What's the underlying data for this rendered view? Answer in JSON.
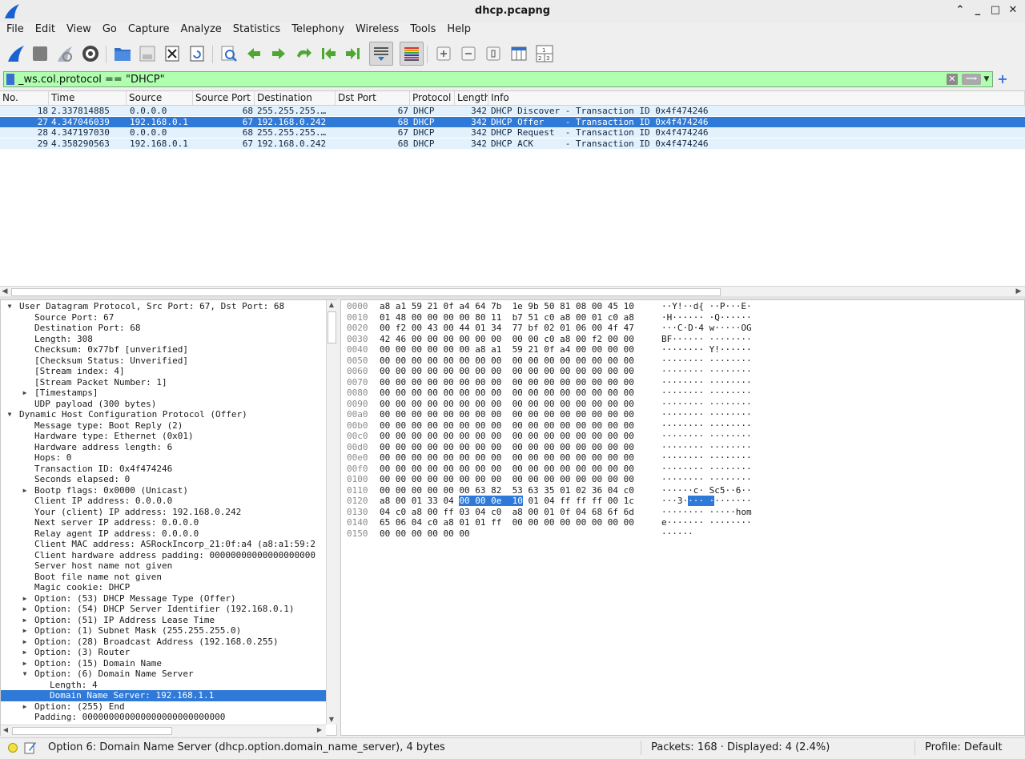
{
  "window": {
    "title": "dhcp.pcapng"
  },
  "menu": [
    "File",
    "Edit",
    "View",
    "Go",
    "Capture",
    "Analyze",
    "Statistics",
    "Telephony",
    "Wireless",
    "Tools",
    "Help"
  ],
  "toolbar": {
    "icons": [
      "shark-fin-start-icon",
      "stop-capture-icon",
      "restart-capture-icon",
      "capture-options-icon",
      "open-file-icon",
      "save-file-icon",
      "close-file-icon",
      "reload-file-icon",
      "find-packet-icon",
      "go-back-icon",
      "go-forward-icon",
      "go-to-packet-icon",
      "go-first-icon",
      "go-last-icon",
      "auto-scroll-icon",
      "colorize-icon",
      "zoom-in-icon",
      "zoom-out-icon",
      "normal-size-icon",
      "resize-columns-icon",
      "layout-icon"
    ]
  },
  "filter": {
    "value": "_ws.col.protocol == \"DHCP\""
  },
  "packet_list": {
    "columns": [
      "No.",
      "Time",
      "Source",
      "Source Port",
      "Destination",
      "Dst Port",
      "Protocol",
      "Length",
      "Info"
    ],
    "rows": [
      {
        "no": "18",
        "time": "2.337814885",
        "source": "0.0.0.0",
        "sport": "68",
        "dest": "255.255.255.…",
        "dport": "67",
        "proto": "DHCP",
        "len": "342",
        "info": "DHCP Discover - Transaction ID 0x4f474246",
        "selected": false
      },
      {
        "no": "27",
        "time": "4.347046039",
        "source": "192.168.0.1",
        "sport": "67",
        "dest": "192.168.0.242",
        "dport": "68",
        "proto": "DHCP",
        "len": "342",
        "info": "DHCP Offer    - Transaction ID 0x4f474246",
        "selected": true
      },
      {
        "no": "28",
        "time": "4.347197030",
        "source": "0.0.0.0",
        "sport": "68",
        "dest": "255.255.255.…",
        "dport": "67",
        "proto": "DHCP",
        "len": "342",
        "info": "DHCP Request  - Transaction ID 0x4f474246",
        "selected": false
      },
      {
        "no": "29",
        "time": "4.358290563",
        "source": "192.168.0.1",
        "sport": "67",
        "dest": "192.168.0.242",
        "dport": "68",
        "proto": "DHCP",
        "len": "342",
        "info": "DHCP ACK      - Transaction ID 0x4f474246",
        "selected": false
      }
    ]
  },
  "details": [
    {
      "indent": 0,
      "tri": "open",
      "text": "User Datagram Protocol, Src Port: 67, Dst Port: 68"
    },
    {
      "indent": 1,
      "tri": "",
      "text": "Source Port: 67"
    },
    {
      "indent": 1,
      "tri": "",
      "text": "Destination Port: 68"
    },
    {
      "indent": 1,
      "tri": "",
      "text": "Length: 308"
    },
    {
      "indent": 1,
      "tri": "",
      "text": "Checksum: 0x77bf [unverified]"
    },
    {
      "indent": 1,
      "tri": "",
      "text": "[Checksum Status: Unverified]"
    },
    {
      "indent": 1,
      "tri": "",
      "text": "[Stream index: 4]"
    },
    {
      "indent": 1,
      "tri": "",
      "text": "[Stream Packet Number: 1]"
    },
    {
      "indent": 1,
      "tri": "closed",
      "text": "[Timestamps]"
    },
    {
      "indent": 1,
      "tri": "",
      "text": "UDP payload (300 bytes)"
    },
    {
      "indent": 0,
      "tri": "open",
      "text": "Dynamic Host Configuration Protocol (Offer)"
    },
    {
      "indent": 1,
      "tri": "",
      "text": "Message type: Boot Reply (2)"
    },
    {
      "indent": 1,
      "tri": "",
      "text": "Hardware type: Ethernet (0x01)"
    },
    {
      "indent": 1,
      "tri": "",
      "text": "Hardware address length: 6"
    },
    {
      "indent": 1,
      "tri": "",
      "text": "Hops: 0"
    },
    {
      "indent": 1,
      "tri": "",
      "text": "Transaction ID: 0x4f474246"
    },
    {
      "indent": 1,
      "tri": "",
      "text": "Seconds elapsed: 0"
    },
    {
      "indent": 1,
      "tri": "closed",
      "text": "Bootp flags: 0x0000 (Unicast)"
    },
    {
      "indent": 1,
      "tri": "",
      "text": "Client IP address: 0.0.0.0"
    },
    {
      "indent": 1,
      "tri": "",
      "text": "Your (client) IP address: 192.168.0.242"
    },
    {
      "indent": 1,
      "tri": "",
      "text": "Next server IP address: 0.0.0.0"
    },
    {
      "indent": 1,
      "tri": "",
      "text": "Relay agent IP address: 0.0.0.0"
    },
    {
      "indent": 1,
      "tri": "",
      "text": "Client MAC address: ASRockIncorp_21:0f:a4 (a8:a1:59:2"
    },
    {
      "indent": 1,
      "tri": "",
      "text": "Client hardware address padding: 00000000000000000000"
    },
    {
      "indent": 1,
      "tri": "",
      "text": "Server host name not given"
    },
    {
      "indent": 1,
      "tri": "",
      "text": "Boot file name not given"
    },
    {
      "indent": 1,
      "tri": "",
      "text": "Magic cookie: DHCP"
    },
    {
      "indent": 1,
      "tri": "closed",
      "text": "Option: (53) DHCP Message Type (Offer)"
    },
    {
      "indent": 1,
      "tri": "closed",
      "text": "Option: (54) DHCP Server Identifier (192.168.0.1)"
    },
    {
      "indent": 1,
      "tri": "closed",
      "text": "Option: (51) IP Address Lease Time"
    },
    {
      "indent": 1,
      "tri": "closed",
      "text": "Option: (1) Subnet Mask (255.255.255.0)"
    },
    {
      "indent": 1,
      "tri": "closed",
      "text": "Option: (28) Broadcast Address (192.168.0.255)"
    },
    {
      "indent": 1,
      "tri": "closed",
      "text": "Option: (3) Router"
    },
    {
      "indent": 1,
      "tri": "closed",
      "text": "Option: (15) Domain Name"
    },
    {
      "indent": 1,
      "tri": "open",
      "text": "Option: (6) Domain Name Server"
    },
    {
      "indent": 2,
      "tri": "",
      "text": "Length: 4"
    },
    {
      "indent": 2,
      "tri": "",
      "text": "Domain Name Server: 192.168.1.1",
      "selected": true
    },
    {
      "indent": 1,
      "tri": "closed",
      "text": "Option: (255) End"
    },
    {
      "indent": 1,
      "tri": "",
      "text": "Padding: 000000000000000000000000000"
    }
  ],
  "bytes": [
    {
      "off": "0000",
      "hex": "a8 a1 59 21 0f a4 64 7b  1e 9b 50 81 08 00 45 10",
      "asc": "··Y!··d{ ··P···E·"
    },
    {
      "off": "0010",
      "hex": "01 48 00 00 00 00 80 11  b7 51 c0 a8 00 01 c0 a8",
      "asc": "·H······ ·Q······"
    },
    {
      "off": "0020",
      "hex": "00 f2 00 43 00 44 01 34  77 bf 02 01 06 00 4f 47",
      "asc": "···C·D·4 w·····OG"
    },
    {
      "off": "0030",
      "hex": "42 46 00 00 00 00 00 00  00 00 c0 a8 00 f2 00 00",
      "asc": "BF······ ········"
    },
    {
      "off": "0040",
      "hex": "00 00 00 00 00 00 a8 a1  59 21 0f a4 00 00 00 00",
      "asc": "········ Y!······"
    },
    {
      "off": "0050",
      "hex": "00 00 00 00 00 00 00 00  00 00 00 00 00 00 00 00",
      "asc": "········ ········"
    },
    {
      "off": "0060",
      "hex": "00 00 00 00 00 00 00 00  00 00 00 00 00 00 00 00",
      "asc": "········ ········"
    },
    {
      "off": "0070",
      "hex": "00 00 00 00 00 00 00 00  00 00 00 00 00 00 00 00",
      "asc": "········ ········"
    },
    {
      "off": "0080",
      "hex": "00 00 00 00 00 00 00 00  00 00 00 00 00 00 00 00",
      "asc": "········ ········"
    },
    {
      "off": "0090",
      "hex": "00 00 00 00 00 00 00 00  00 00 00 00 00 00 00 00",
      "asc": "········ ········"
    },
    {
      "off": "00a0",
      "hex": "00 00 00 00 00 00 00 00  00 00 00 00 00 00 00 00",
      "asc": "········ ········"
    },
    {
      "off": "00b0",
      "hex": "00 00 00 00 00 00 00 00  00 00 00 00 00 00 00 00",
      "asc": "········ ········"
    },
    {
      "off": "00c0",
      "hex": "00 00 00 00 00 00 00 00  00 00 00 00 00 00 00 00",
      "asc": "········ ········"
    },
    {
      "off": "00d0",
      "hex": "00 00 00 00 00 00 00 00  00 00 00 00 00 00 00 00",
      "asc": "········ ········"
    },
    {
      "off": "00e0",
      "hex": "00 00 00 00 00 00 00 00  00 00 00 00 00 00 00 00",
      "asc": "········ ········"
    },
    {
      "off": "00f0",
      "hex": "00 00 00 00 00 00 00 00  00 00 00 00 00 00 00 00",
      "asc": "········ ········"
    },
    {
      "off": "0100",
      "hex": "00 00 00 00 00 00 00 00  00 00 00 00 00 00 00 00",
      "asc": "········ ········"
    },
    {
      "off": "0110",
      "hex": "00 00 00 00 00 00 63 82  53 63 35 01 02 36 04 c0",
      "asc": "······c· Sc5··6··"
    },
    {
      "off": "0120",
      "hex_pre": "a8 00 01 33 04 ",
      "hex_hl": "00 00 0e  10",
      "hex_post": " 01 04 ff ff ff 00 1c",
      "asc_pre": "···3·",
      "asc_hl": "··· ·",
      "asc_post": "·······"
    },
    {
      "off": "0130",
      "hex": "04 c0 a8 00 ff 03 04 c0  a8 00 01 0f 04 68 6f 6d",
      "asc": "········ ·····hom"
    },
    {
      "off": "0140",
      "hex": "65 06 04 c0 a8 01 01 ff  00 00 00 00 00 00 00 00",
      "asc": "e······· ········"
    },
    {
      "off": "0150",
      "hex": "00 00 00 00 00 00",
      "asc": "······"
    }
  ],
  "status": {
    "message": "Option 6: Domain Name Server (dhcp.option.domain_name_server), 4 bytes",
    "packets": "Packets: 168 · Displayed: 4 (2.4%)",
    "profile": "Profile: Default"
  },
  "colors": {
    "filter_ok": "#afffaf",
    "selection": "#2f7ad8",
    "row_bg": "#e3f1fd"
  }
}
